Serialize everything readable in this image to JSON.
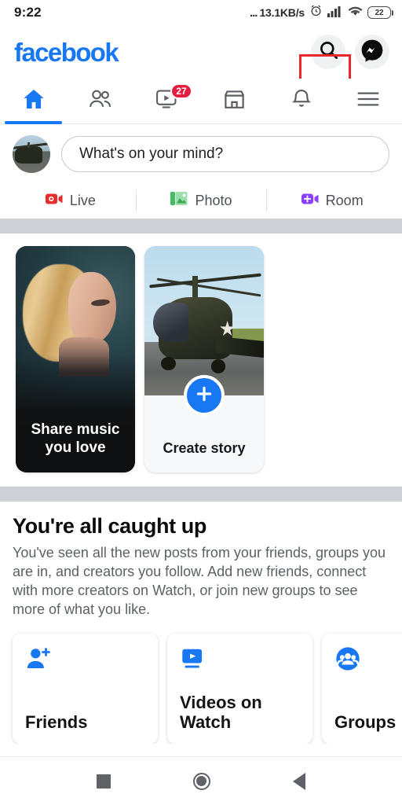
{
  "status_bar": {
    "time": "9:22",
    "network_speed": "13.1KB/s",
    "speed_prefix": "...",
    "alarm_icon": "alarm-clock-icon",
    "signal_icon": "cellular-signal-icon",
    "wifi_icon": "wifi-icon",
    "battery_level": "22"
  },
  "header": {
    "wordmark": "facebook",
    "brand_color": "#1877f2",
    "search_icon": "search-icon",
    "messenger_icon": "messenger-icon",
    "annotation_color": "#e8262b"
  },
  "nav_tabs": [
    {
      "name": "home",
      "icon": "home-icon",
      "active": true,
      "badge": ""
    },
    {
      "name": "friends",
      "icon": "friends-icon",
      "active": false,
      "badge": ""
    },
    {
      "name": "watch",
      "icon": "watch-video-icon",
      "active": false,
      "badge": "27"
    },
    {
      "name": "marketplace",
      "icon": "marketplace-store-icon",
      "active": false,
      "badge": ""
    },
    {
      "name": "notifications",
      "icon": "bell-icon",
      "active": false,
      "badge": ""
    },
    {
      "name": "menu",
      "icon": "hamburger-menu-icon",
      "active": false,
      "badge": ""
    }
  ],
  "composer": {
    "avatar_icon": "user-avatar-helicopter-photo",
    "placeholder": "What's on your mind?",
    "actions": [
      {
        "label": "Live",
        "icon": "live-video-icon",
        "color": "#e62e2e"
      },
      {
        "label": "Photo",
        "icon": "photo-gallery-icon",
        "color": "#45bd62"
      },
      {
        "label": "Room",
        "icon": "room-video-icon",
        "color": "#8a3ffc"
      }
    ]
  },
  "stories": [
    {
      "name": "share-music",
      "caption_line1": "Share music",
      "caption_line2": "you love",
      "type": "music"
    },
    {
      "name": "create-story",
      "caption": "Create story",
      "type": "create",
      "plus_icon": "plus-icon",
      "plus_color": "#1877f2"
    }
  ],
  "caught_up": {
    "title": "You're all caught up",
    "body": "You've seen all the new posts from your friends, groups you are in, and creators you follow. Add new friends, connect with more creators on Watch, or join new groups to see more of what you like."
  },
  "suggestion_cards": [
    {
      "label": "Friends",
      "icon": "add-friend-icon",
      "color": "#1877f2"
    },
    {
      "label": "Videos on Watch",
      "icon": "watch-video-icon",
      "color": "#1877f2"
    },
    {
      "label": "Groups",
      "icon": "groups-icon",
      "color": "#1877f2"
    }
  ],
  "android_nav": {
    "recents_icon": "square-recents-icon",
    "home_icon": "circle-home-icon",
    "back_icon": "triangle-back-icon"
  }
}
